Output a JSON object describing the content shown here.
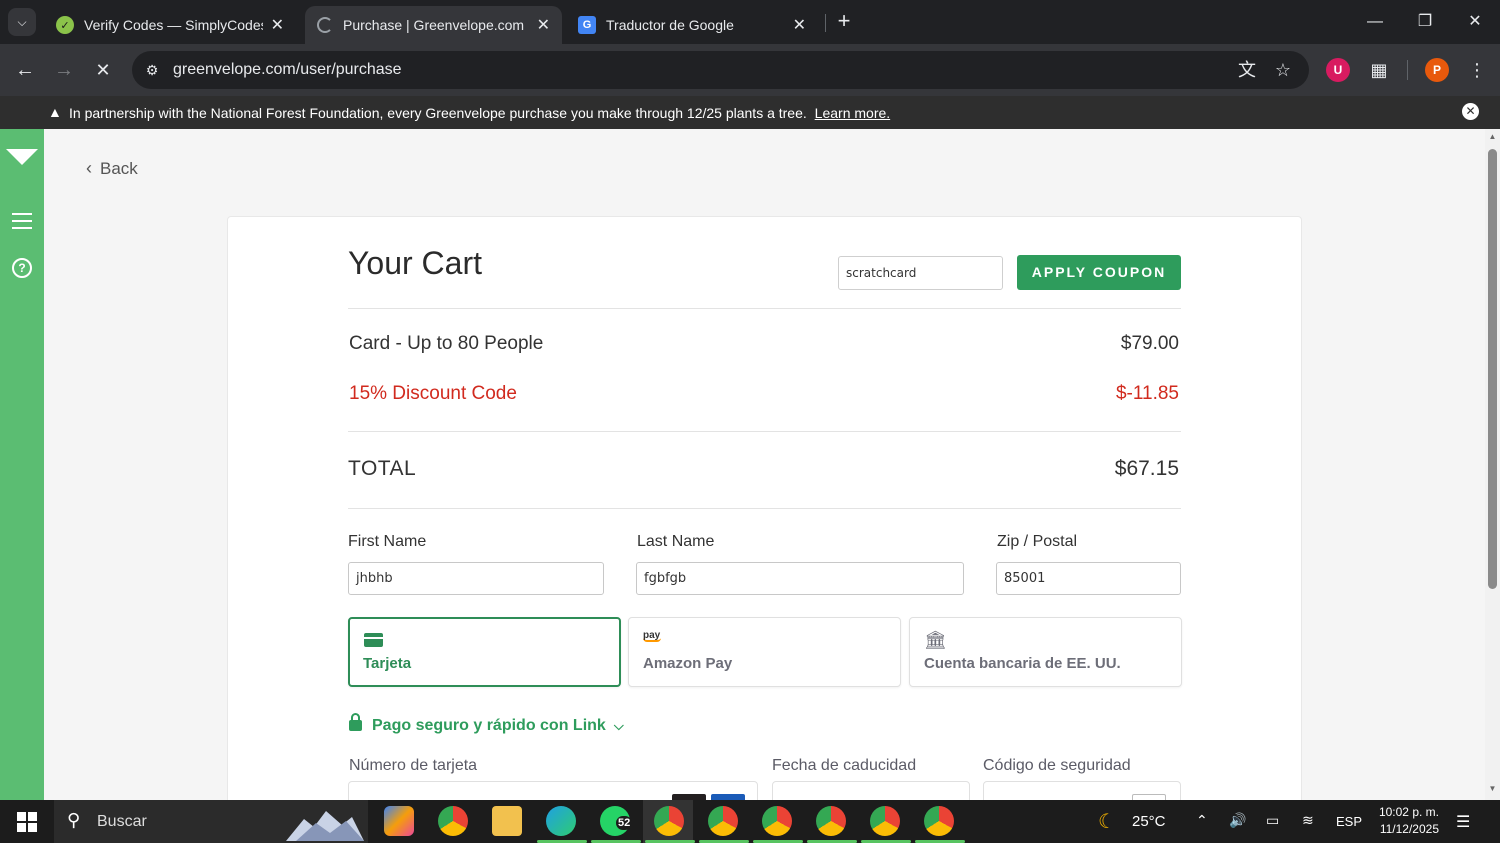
{
  "browser": {
    "tabs": [
      {
        "title": "Verify Codes — SimplyCodes",
        "icon": "simplycodes-icon"
      },
      {
        "title": "Purchase | Greenvelope.com",
        "icon": "loading-icon",
        "active": true
      },
      {
        "title": "Traductor de Google",
        "icon": "google-translate-icon"
      }
    ],
    "url": "greenvelope.com/user/purchase",
    "profile_initial": "P",
    "extension_initial": "U"
  },
  "banner": {
    "text": "In partnership with the National Forest Foundation, every Greenvelope purchase you make through 12/25 plants a tree.",
    "link": "Learn more."
  },
  "page": {
    "back_label": "Back",
    "cart": {
      "title": "Your Cart",
      "coupon_value": "scratchcard",
      "apply_label": "APPLY COUPON",
      "items": [
        {
          "label": "Card - Up to 80 People",
          "value": "$79.00"
        },
        {
          "label": "15% Discount Code",
          "value": "$-11.85",
          "discount": true
        }
      ],
      "total_label": "TOTAL",
      "total_value": "$67.15"
    },
    "form": {
      "first_name_label": "First Name",
      "first_name_value": "jhbhb",
      "last_name_label": "Last Name",
      "last_name_value": "fgbfgb",
      "zip_label": "Zip / Postal",
      "zip_value": "85001"
    },
    "payment": {
      "options": [
        {
          "label": "Tarjeta",
          "icon": "credit-card-icon",
          "selected": true
        },
        {
          "label": "Amazon Pay",
          "icon": "amazon-pay-icon",
          "icon_text": "pay"
        },
        {
          "label": "Cuenta bancaria de EE. UU.",
          "icon": "bank-icon"
        }
      ],
      "link_text": "Pago seguro y rápido con Link",
      "card_number_label": "Número de tarjeta",
      "expiry_label": "Fecha de caducidad",
      "cvc_label": "Código de seguridad"
    }
  },
  "colors": {
    "brand_green": "#2e9c5c",
    "sidebar_green": "#5bbd72",
    "discount_red": "#d12a1e"
  },
  "taskbar": {
    "search_label": "Buscar",
    "whatsapp_badge": "52",
    "weather": "25°C",
    "language": "ESP",
    "time": "10:02 p. m.",
    "date": "11/12/2025"
  }
}
